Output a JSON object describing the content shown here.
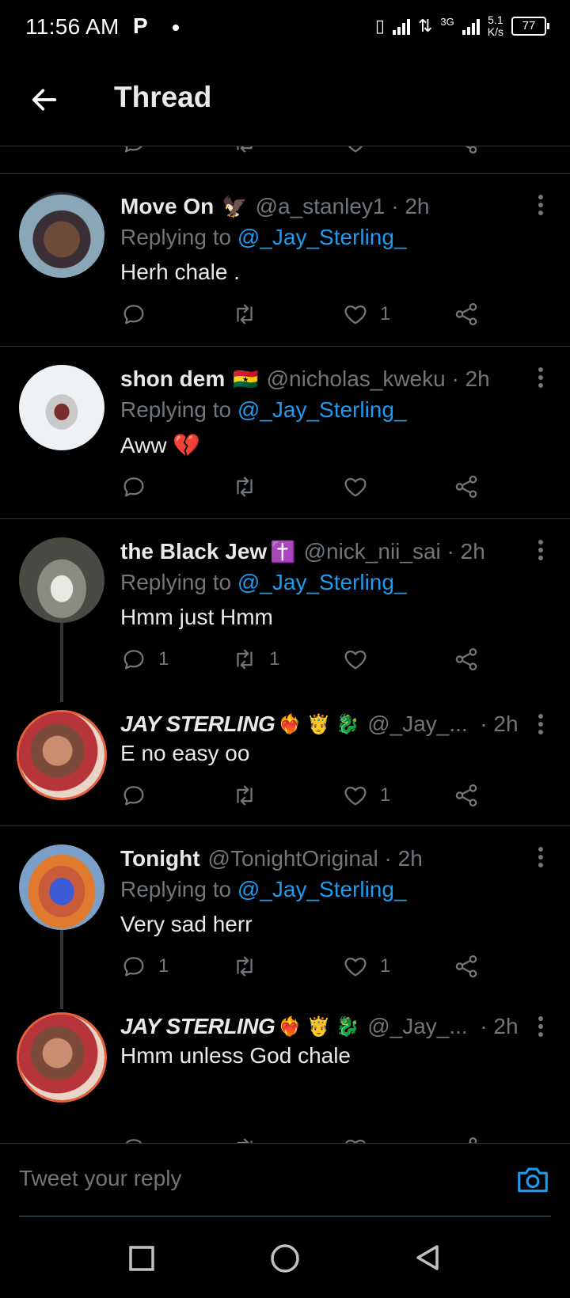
{
  "status_bar": {
    "time": "11:56 AM",
    "notification_icon": "P",
    "network": "3G",
    "speed_value": "5.1",
    "speed_unit": "K/s",
    "battery": "77"
  },
  "header": {
    "title": "Thread",
    "back_icon": "arrow-left"
  },
  "tweets": [
    {
      "name": "Move On",
      "badge": "🦅",
      "handle": "@a_stanley1",
      "time": "· 2h",
      "replying_prefix": "Replying to",
      "replying_to": "@_Jay_Sterling_",
      "text": "Herh chale .",
      "replies": "",
      "retweets": "",
      "likes": "1"
    },
    {
      "name": "shon dem",
      "badge": "🇬🇭",
      "handle": "@nicholas_kweku",
      "time": "· 2h",
      "replying_prefix": "Replying to",
      "replying_to": "@_Jay_Sterling_",
      "text": "Aww 💔",
      "replies": "",
      "retweets": "",
      "likes": ""
    },
    {
      "name": "the Black Jew",
      "badge": "✝️",
      "handle": "@nick_nii_sai",
      "time": "· 2h",
      "replying_prefix": "Replying to",
      "replying_to": "@_Jay_Sterling_",
      "text": "Hmm just Hmm",
      "replies": "1",
      "retweets": "1",
      "likes": ""
    },
    {
      "name": "JAY STERLING",
      "badge": "❤️‍🔥 🤴 🐉",
      "handle": "@_Jay_...",
      "time": "· 2h",
      "text": "E no easy oo",
      "replies": "",
      "retweets": "",
      "likes": "1"
    },
    {
      "name": "Tonight",
      "badge": "",
      "handle": "@TonightOriginal",
      "time": "· 2h",
      "replying_prefix": "Replying to",
      "replying_to": "@_Jay_Sterling_",
      "text": "Very sad herr",
      "replies": "1",
      "retweets": "",
      "likes": "1"
    },
    {
      "name": "JAY STERLING",
      "badge": "❤️‍🔥 🤴 🐉",
      "handle": "@_Jay_...",
      "time": "· 2h",
      "text": "Hmm unless God chale"
    }
  ],
  "composer": {
    "placeholder": "Tweet your reply",
    "camera_icon": "camera-icon"
  },
  "colors": {
    "background": "#000000",
    "text_primary": "#e7e9ea",
    "text_secondary": "#71767b",
    "accent": "#1d9bf0",
    "divider": "#2f3336",
    "avatar_ring": "#e8603c"
  }
}
